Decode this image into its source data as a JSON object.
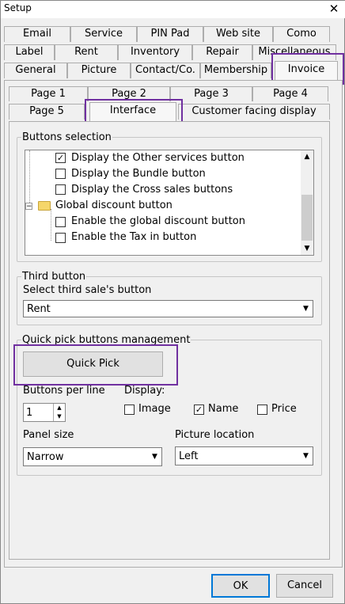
{
  "window": {
    "title": "Setup",
    "close_glyph": "✕"
  },
  "tabs_row1": [
    "Email",
    "Service",
    "PIN Pad",
    "Web site",
    "Como"
  ],
  "tabs_row2": [
    "Label",
    "Rent",
    "Inventory",
    "Repair",
    "Miscellaneous"
  ],
  "tabs_row3": [
    "General",
    "Picture",
    "Contact/Co.",
    "Membership",
    "Invoice"
  ],
  "subtabs_row1": [
    "Page 1",
    "Page 2",
    "Page 3",
    "Page 4"
  ],
  "subtabs_row2": [
    "Page 5",
    "Interface",
    "Customer facing display"
  ],
  "buttons_selection": {
    "label": "Buttons selection",
    "items": [
      {
        "label": "Display the Other services button",
        "checked": true
      },
      {
        "label": "Display the Bundle button",
        "checked": false
      },
      {
        "label": "Display the Cross sales buttons",
        "checked": false
      }
    ],
    "folder": {
      "label": "Global discount button",
      "toggle": "−"
    },
    "sub_items": [
      {
        "label": "Enable the global discount button",
        "checked": false
      },
      {
        "label": "Enable the Tax in button",
        "checked": false
      }
    ]
  },
  "third_button": {
    "group_label": "Third button",
    "select_label": "Select third sale's button",
    "value": "Rent"
  },
  "quick_pick": {
    "group_label": "Quick pick buttons management",
    "button_label": "Quick Pick",
    "per_line_label": "Buttons per line",
    "per_line_value": "1",
    "display_label": "Display:",
    "image_label": "Image",
    "image_checked": false,
    "name_label": "Name",
    "name_checked": true,
    "price_label": "Price",
    "price_checked": false,
    "panel_size_label": "Panel size",
    "panel_size_value": "Narrow",
    "picture_location_label": "Picture location",
    "picture_location_value": "Left"
  },
  "footer": {
    "ok_label": "OK",
    "cancel_label": "Cancel"
  },
  "colors": {
    "highlight": "#7030a0"
  }
}
